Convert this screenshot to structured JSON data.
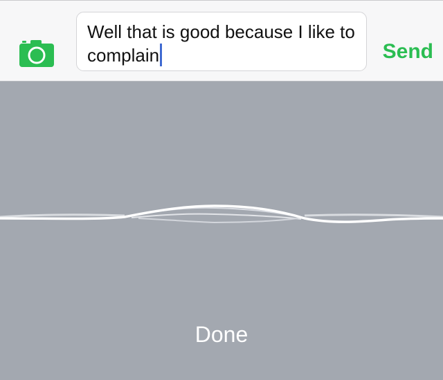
{
  "compose": {
    "message_text": "Well that is good because I like to complain",
    "send_label": "Send",
    "camera_icon": "camera-icon"
  },
  "dictation": {
    "done_label": "Done",
    "waveform_icon": "audio-waveform-icon"
  },
  "colors": {
    "accent_green": "#2bbd52",
    "caret_blue": "#3f6ad1",
    "dictation_background": "#a3a8b0",
    "compose_background": "#f7f7f8"
  }
}
